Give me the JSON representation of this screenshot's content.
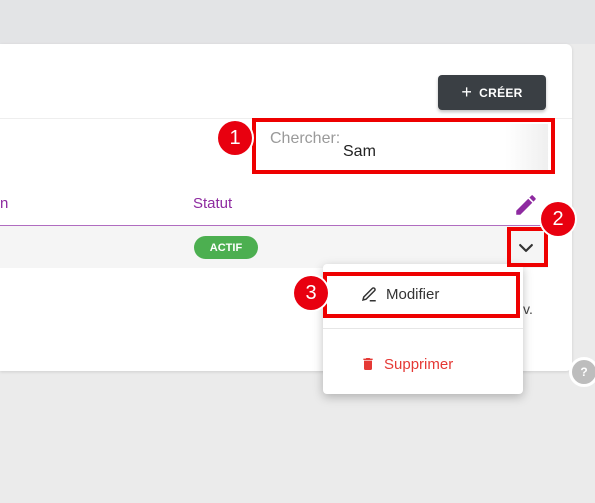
{
  "toolbar": {
    "create_label": "CRÉER",
    "create_icon": "plus-icon"
  },
  "search": {
    "label": "Chercher:",
    "value": "Sam"
  },
  "table": {
    "columns": [
      {
        "label": "n"
      },
      {
        "label": "Statut"
      }
    ],
    "rows": [
      {
        "status": "ACTIF",
        "status_color": "#4caf50"
      }
    ],
    "trailing_text": "v."
  },
  "row_menu": {
    "items": [
      {
        "label": "Modifier",
        "icon": "edit-pen-icon",
        "color": "#333333"
      },
      {
        "label": "Supprimer",
        "icon": "trash-icon",
        "color": "#e53935"
      }
    ]
  },
  "annotations": [
    {
      "number": "1",
      "target": "search-field"
    },
    {
      "number": "2",
      "target": "row-actions-chevron"
    },
    {
      "number": "3",
      "target": "menu-item-modifier"
    }
  ],
  "colors": {
    "accent": "#8e2aa0",
    "highlight": "#ee0000",
    "dark_button": "#3a3f44"
  },
  "help": {
    "icon": "question-icon",
    "glyph": "?"
  }
}
